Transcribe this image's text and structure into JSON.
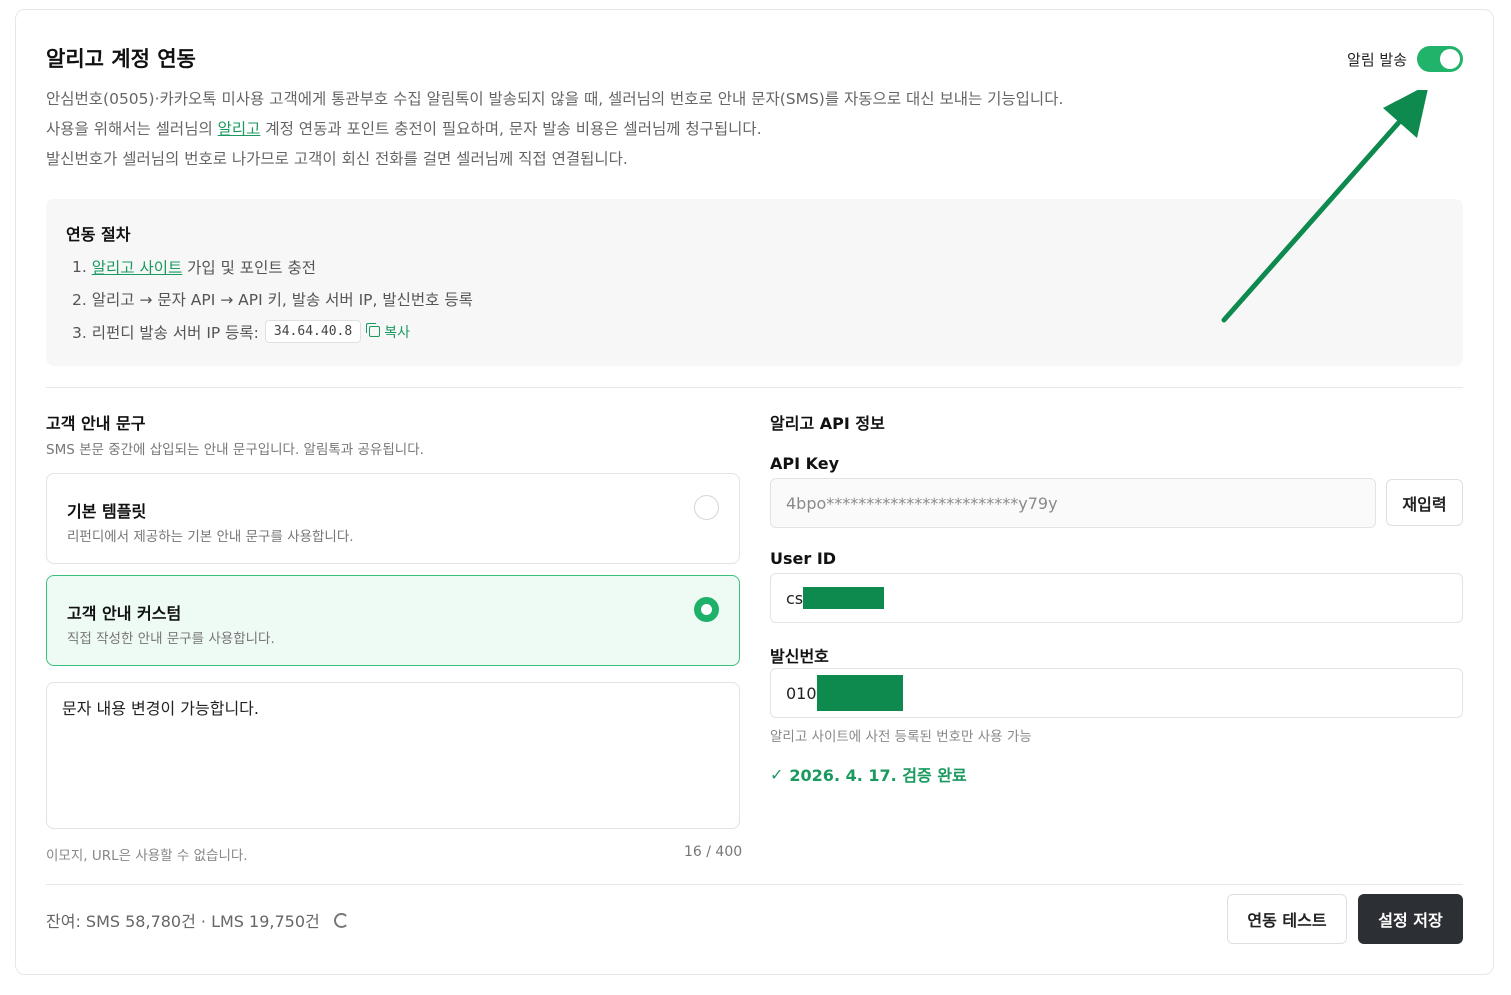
{
  "header": {
    "title": "알리고 계정 연동",
    "toggle_label": "알림 발송",
    "toggle_on": true,
    "desc_line1": "안심번호(0505)·카카오톡 미사용 고객에게 통관부호 수집 알림톡이 발송되지 않을 때, 셀러님의 번호로 안내 문자(SMS)를 자동으로 대신 보내는 기능입니다.",
    "desc_line2_pre": "사용을 위해서는 셀러님의 ",
    "desc_line2_link": "알리고",
    "desc_line2_post": " 계정 연동과 포인트 충전이 필요하며, 문자 발송 비용은 셀러님께 청구됩니다.",
    "desc_line3": "발신번호가 셀러님의 번호로 나가므로 고객이 회신 전화를 걸면 셀러님께 직접 연결됩니다."
  },
  "steps": {
    "title": "연동 절차",
    "s1_num": "1.",
    "s1_link": "알리고 사이트",
    "s1_rest": "가입 및 포인트 충전",
    "s2": "2. 알리고 → 문자 API → API 키, 발송 서버 IP, 발신번호 등록",
    "s3": "3. 리펀디 발송 서버 IP 등록:",
    "ip": "34.64.40.8",
    "copy_label": "복사"
  },
  "guide": {
    "title": "고객 안내 문구",
    "subtitle": "SMS 본문 중간에 삽입되는 안내 문구입니다. 알림톡과 공유됩니다.",
    "options": [
      {
        "title": "기본 템플릿",
        "subtitle": "리펀디에서 제공하는 기본 안내 문구를 사용합니다.",
        "selected": false
      },
      {
        "title": "고객 안내 커스텀",
        "subtitle": "직접 작성한 안내 문구를 사용합니다.",
        "selected": true
      }
    ],
    "textarea_value": "문자 내용 변경이 가능합니다.",
    "hint": "이모지, URL은 사용할 수 없습니다.",
    "counter": "16 / 400"
  },
  "api": {
    "title": "알리고 API 정보",
    "api_key_label": "API Key",
    "api_key_value": "4bpo************************y79y",
    "reenter_label": "재입력",
    "user_id_label": "User ID",
    "user_id_value": "cs",
    "sender_label": "발신번호",
    "sender_value": "010",
    "sender_hint": "알리고 사이트에 사전 등록된 번호만 사용 가능",
    "verified": "2026. 4. 17. 검증 완료"
  },
  "footer": {
    "balance": "잔여: SMS 58,780건 · LMS 19,750건",
    "test_label": "연동 테스트",
    "save_label": "설정 저장"
  },
  "colors": {
    "accent": "#1a9a5e",
    "toggle": "#22b36a",
    "arrow": "#0e8a4f",
    "dark_button": "#2c2f33"
  }
}
